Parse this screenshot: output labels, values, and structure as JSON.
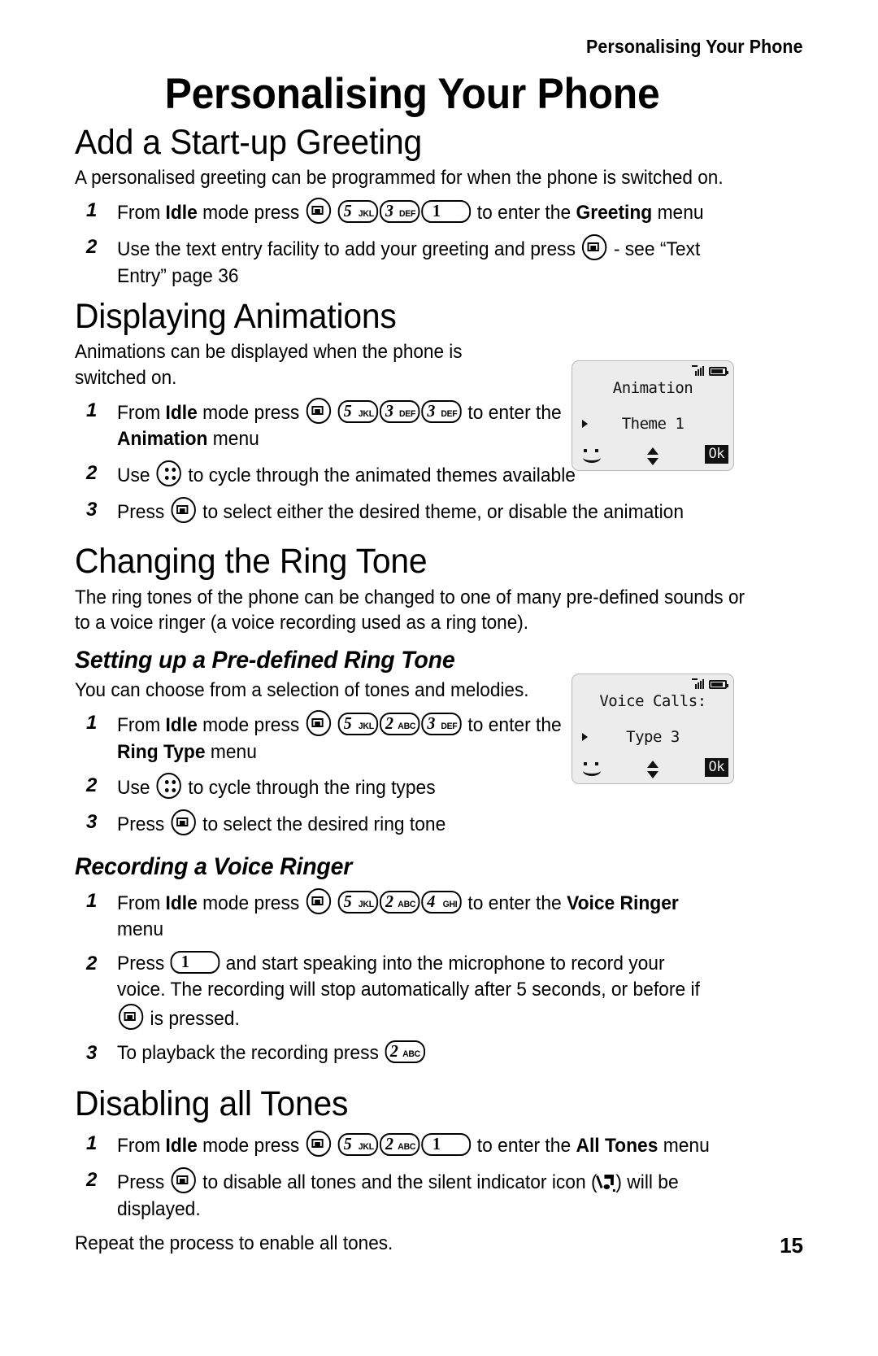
{
  "header": {
    "running_title": "Personalising Your Phone"
  },
  "chapter_title": "Personalising Your Phone",
  "sections": {
    "greeting": {
      "heading": "Add a Start-up Greeting",
      "intro": "A personalised greeting can be programmed for when the phone is switched on.",
      "step1": {
        "num": "1",
        "a": "From ",
        "idle": "Idle",
        "b": " mode press ",
        "c": " to enter the ",
        "menu": "Greeting",
        "d": " menu"
      },
      "step2": {
        "num": "2",
        "a": "Use the text entry facility to add your greeting and press ",
        "b": " - see “Text Entry” page 36"
      }
    },
    "animations": {
      "heading": "Displaying Animations",
      "intro": "Animations can be displayed when the phone is switched on.",
      "step1": {
        "num": "1",
        "a": "From ",
        "idle": "Idle",
        "b": " mode press ",
        "c": " to enter the ",
        "menu": "Animation",
        "d": " menu"
      },
      "step2": {
        "num": "2",
        "a": "Use ",
        "b": " to cycle through the animated themes available"
      },
      "step3": {
        "num": "3",
        "a": "Press ",
        "b": " to select either the desired theme, or disable the animation"
      }
    },
    "ringtone": {
      "heading": "Changing the Ring Tone",
      "intro": "The ring tones of the phone can be changed to one of many pre-defined sounds or to a voice ringer (a voice recording used as a ring tone).",
      "predefined": {
        "heading": "Setting up a Pre-defined Ring Tone",
        "intro": "You can choose from a selection of tones and melodies.",
        "step1": {
          "num": "1",
          "a": "From ",
          "idle": "Idle",
          "b": " mode press ",
          "c": " to enter the ",
          "menu": "Ring Type",
          "d": " menu"
        },
        "step2": {
          "num": "2",
          "a": "Use ",
          "b": " to cycle through the ring types"
        },
        "step3": {
          "num": "3",
          "a": "Press ",
          "b": " to select the desired ring tone"
        }
      },
      "voiceringer": {
        "heading": "Recording a Voice Ringer",
        "step1": {
          "num": "1",
          "a": "From ",
          "idle": "Idle",
          "b": " mode press ",
          "c": " to enter the ",
          "menu": "Voice Ringer",
          "d": " menu"
        },
        "step2": {
          "num": "2",
          "a": "Press ",
          "b": " and start speaking into the microphone to record your voice. The recording will stop automatically after 5 seconds, or before if ",
          "c": " is pressed."
        },
        "step3": {
          "num": "3",
          "a": "To playback the recording press ",
          "b": ""
        }
      }
    },
    "alltones": {
      "heading": "Disabling all Tones",
      "step1": {
        "num": "1",
        "a": "From ",
        "idle": "Idle",
        "b": " mode press ",
        "c": " to enter the ",
        "menu": "All Tones",
        "d": " menu"
      },
      "step2": {
        "num": "2",
        "a": "Press ",
        "b": " to disable all tones and the silent indicator icon (",
        "c": ") will be displayed."
      },
      "outro": "Repeat the process to enable all tones."
    }
  },
  "keys": {
    "k5": {
      "digit": "5",
      "letters": "JKL"
    },
    "k3": {
      "digit": "3",
      "letters": "DEF"
    },
    "k2": {
      "digit": "2",
      "letters": "ABC"
    },
    "k4": {
      "digit": "4",
      "letters": "GHI"
    },
    "k1": {
      "digit": "1",
      "letters": ""
    }
  },
  "displays": {
    "animation": {
      "title": "Animation",
      "value": "Theme 1",
      "ok_label": "Ok"
    },
    "voicecalls": {
      "title": "Voice Calls:",
      "value": "Type 3",
      "ok_label": "Ok"
    }
  },
  "footer": {
    "page_number": "15"
  }
}
